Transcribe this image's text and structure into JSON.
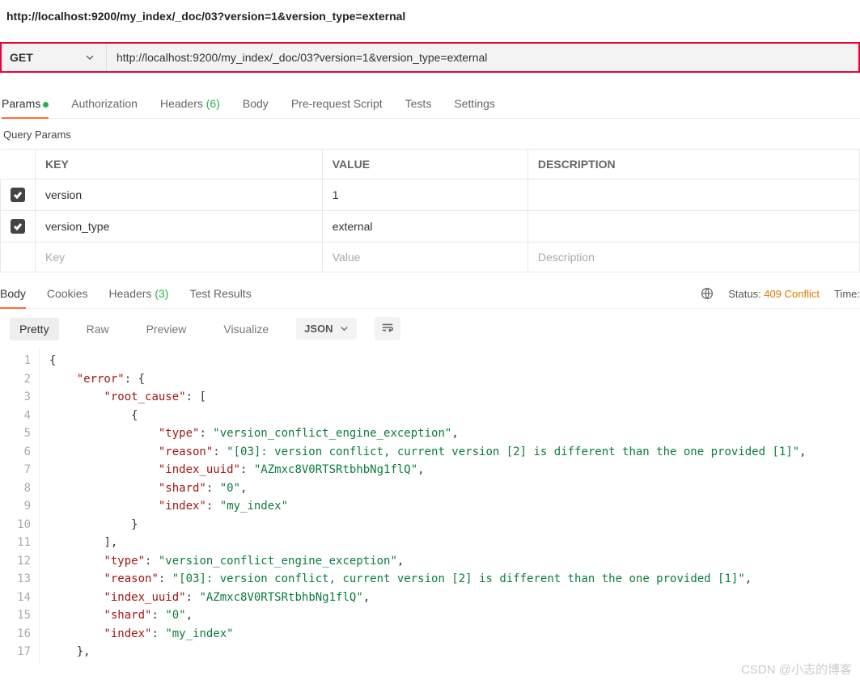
{
  "header_url": "http://localhost:9200/my_index/_doc/03?version=1&version_type=external",
  "request": {
    "method": "GET",
    "url": "http://localhost:9200/my_index/_doc/03?version=1&version_type=external"
  },
  "tabs": {
    "params": "Params",
    "authorization": "Authorization",
    "headers": "Headers",
    "headers_count": "(6)",
    "body": "Body",
    "prerequest": "Pre-request Script",
    "tests": "Tests",
    "settings": "Settings"
  },
  "section_label": "Query Params",
  "params_table": {
    "headers": {
      "key": "KEY",
      "value": "VALUE",
      "description": "DESCRIPTION"
    },
    "rows": [
      {
        "key": "version",
        "value": "1"
      },
      {
        "key": "version_type",
        "value": "external"
      }
    ],
    "placeholder": {
      "key": "Key",
      "value": "Value",
      "description": "Description"
    }
  },
  "response_tabs": {
    "body": "Body",
    "cookies": "Cookies",
    "headers": "Headers",
    "headers_count": "(3)",
    "test_results": "Test Results"
  },
  "response_status": {
    "status_label": "Status:",
    "status_value": "409 Conflict",
    "time_label": "Time:"
  },
  "view_modes": {
    "pretty": "Pretty",
    "raw": "Raw",
    "preview": "Preview",
    "visualize": "Visualize",
    "format": "JSON"
  },
  "json_body": {
    "error": {
      "root_cause": [
        {
          "type": "version_conflict_engine_exception",
          "reason": "[03]: version conflict, current version [2] is different than the one provided [1]",
          "index_uuid": "AZmxc8V0RTSRtbhbNg1flQ",
          "shard": "0",
          "index": "my_index"
        }
      ],
      "type": "version_conflict_engine_exception",
      "reason": "[03]: version conflict, current version [2] is different than the one provided [1]",
      "index_uuid": "AZmxc8V0RTSRtbhbNg1flQ",
      "shard": "0",
      "index": "my_index"
    }
  },
  "watermark": "CSDN @小志的博客"
}
